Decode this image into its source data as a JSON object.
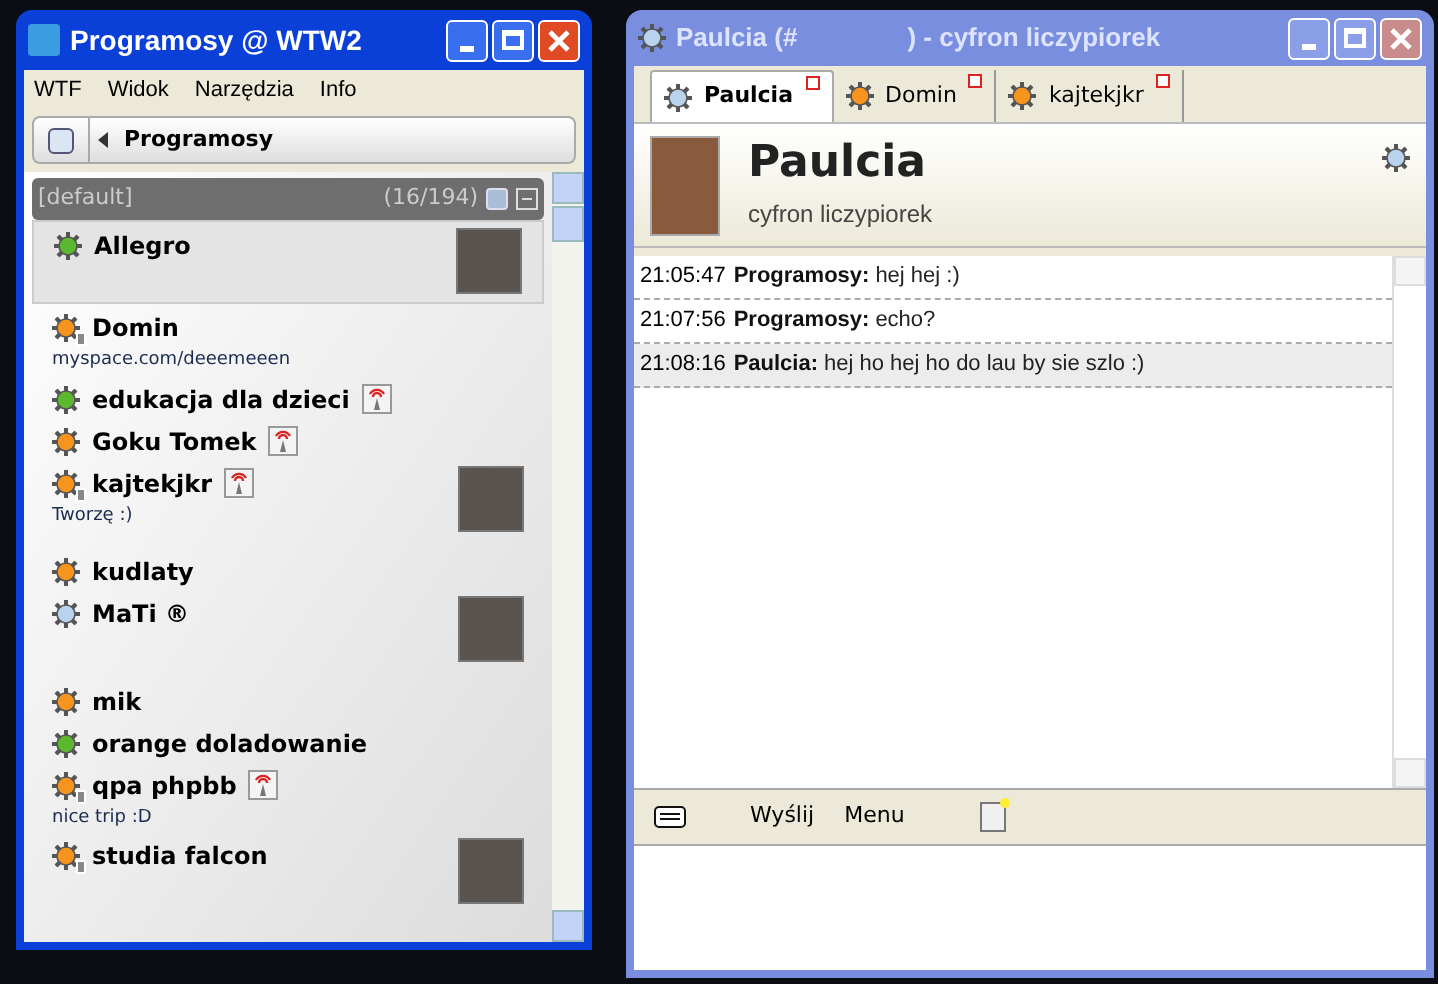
{
  "contacts_window": {
    "title": "Programosy @ WTW2",
    "menu": [
      "WTF",
      "Widok",
      "Narzędzia",
      "Info"
    ],
    "profile": {
      "name": "Programosy"
    },
    "group": {
      "name": "[default]",
      "count": "(16/194)"
    },
    "contacts": [
      {
        "name": "Allegro",
        "color": "#5cb82e",
        "away_badge": false,
        "radio": false,
        "avatar": true,
        "selected": true
      },
      {
        "name": "Domin",
        "color": "#f7941d",
        "away_badge": true,
        "radio": false,
        "avatar": false,
        "description": "myspace.com/deeemeeen",
        "selected": false
      },
      {
        "name": "edukacja dla dzieci",
        "color": "#5cb82e",
        "away_badge": false,
        "radio": true,
        "avatar": false,
        "selected": false
      },
      {
        "name": "Goku Tomek",
        "color": "#f7941d",
        "away_badge": false,
        "radio": true,
        "avatar": false,
        "selected": false
      },
      {
        "name": "kajtekjkr",
        "color": "#f7941d",
        "away_badge": true,
        "radio": true,
        "avatar": true,
        "description": "Tworzę :)",
        "selected": false
      },
      {
        "name": "kudlaty",
        "color": "#f7941d",
        "away_badge": false,
        "radio": false,
        "avatar": false,
        "selected": false
      },
      {
        "name": "MaTi ®",
        "color": "#b9d3ee",
        "away_badge": false,
        "radio": false,
        "avatar": true,
        "selected": false
      },
      {
        "name": "mik",
        "color": "#f7941d",
        "away_badge": false,
        "radio": false,
        "avatar": false,
        "selected": false
      },
      {
        "name": "orange doladowanie",
        "color": "#5cb82e",
        "away_badge": false,
        "radio": false,
        "avatar": false,
        "selected": false
      },
      {
        "name": "qpa phpbb",
        "color": "#f7941d",
        "away_badge": true,
        "radio": true,
        "avatar": false,
        "description": "nice trip :D",
        "selected": false
      },
      {
        "name": "studia falcon",
        "color": "#f7941d",
        "away_badge": true,
        "radio": false,
        "avatar": true,
        "selected": false
      }
    ]
  },
  "chat_window": {
    "title_start": "Paulcia (#",
    "title_end": ") - cyfron liczypiorek",
    "tabs": [
      {
        "label": "Paulcia",
        "color": "#b9d3ee",
        "selected": true
      },
      {
        "label": "Domin",
        "color": "#f7941d",
        "selected": false
      },
      {
        "label": "kajtekjkr",
        "color": "#f7941d",
        "selected": false
      }
    ],
    "header": {
      "name": "Paulcia",
      "description": "cyfron liczypiorek",
      "color": "#b9d3ee"
    },
    "messages": [
      {
        "time": "21:05:47",
        "sender": "Programosy:",
        "text": "hej hej :)",
        "incoming": false
      },
      {
        "time": "21:07:56",
        "sender": "Programosy:",
        "text": "echo?",
        "incoming": false
      },
      {
        "time": "21:08:16",
        "sender": "Paulcia:",
        "text": "hej ho hej ho do lau by sie szlo :)",
        "incoming": true
      }
    ],
    "toolbar": [
      "Wyślij",
      "Menu"
    ]
  }
}
